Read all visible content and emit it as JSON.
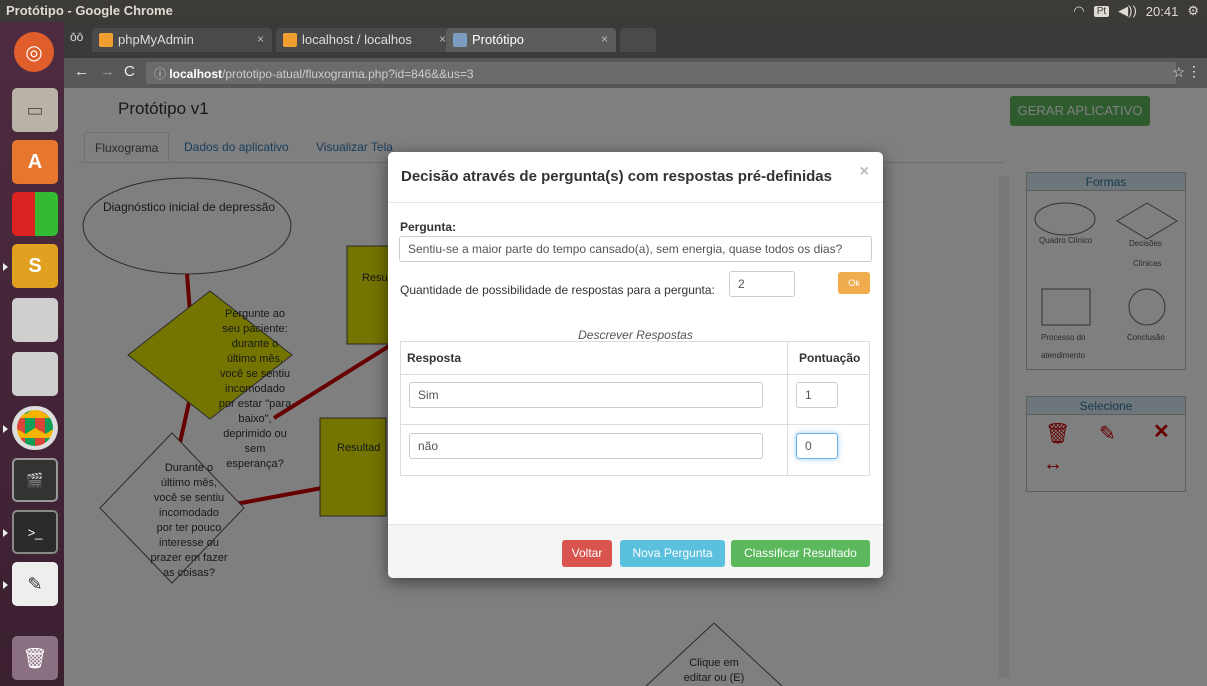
{
  "window": {
    "title": "Protótipo - Google Chrome",
    "time": "20:41",
    "kbd": "Pt"
  },
  "tabs": [
    {
      "label": "phpMyAdmin"
    },
    {
      "label": "localhost / localhos"
    },
    {
      "label": "Protótipo"
    }
  ],
  "address": {
    "host": "localhost",
    "path": "/prototipo-atual/fluxograma.php?id=846&&us=3"
  },
  "page": {
    "title": "Protótipo v1",
    "generate_button": "GERAR APLICATIVO",
    "tabs": [
      "Fluxograma",
      "Dados do aplicativo",
      "Visualizar Tela"
    ]
  },
  "flow": {
    "start": "Diagnóstico inicial de depressão",
    "q1": [
      "Pergunte ao",
      "seu paciente:",
      "durante o",
      "último mês,",
      "você se sentiu",
      "incomodado",
      "por estar \"para",
      "baixo\",",
      "deprimido ou",
      "sem",
      "esperança?"
    ],
    "q2": [
      "Durante o",
      "último mês,",
      "você se sentiu",
      "incomodado",
      "por ter pouco",
      "interesse ou",
      "prazer em fazer",
      "as coisas?"
    ],
    "res_a": "Resu",
    "res_b": "Resultad",
    "click": [
      "Clique em",
      "editar ou (E)"
    ]
  },
  "shapes_panel": {
    "title": "Formas",
    "items": [
      "Quadro Clínico",
      "Decisões",
      "Clínicas",
      "Processo do",
      "atendimento",
      "Conclusão"
    ]
  },
  "select_panel": {
    "title": "Selecione"
  },
  "modal": {
    "title": "Decisão através de pergunta(s) com respostas pré-definidas",
    "close": "×",
    "question_label": "Pergunta:",
    "question_value": "Sentiu-se a maior parte do tempo cansado(a), sem energia, quase todos os dias?",
    "qty_label": "Quantidade de possibilidade de respostas para a pergunta:",
    "qty_value": "2",
    "ok": "Ok",
    "caption": "Descrever Respostas",
    "col_answer": "Resposta",
    "col_score": "Pontuação",
    "rows": [
      {
        "answer": "Sim",
        "score": "1"
      },
      {
        "answer": "não",
        "score": "0"
      }
    ],
    "btn_back": "Voltar",
    "btn_new": "Nova Pergunta",
    "btn_classify": "Classificar Resultado"
  }
}
